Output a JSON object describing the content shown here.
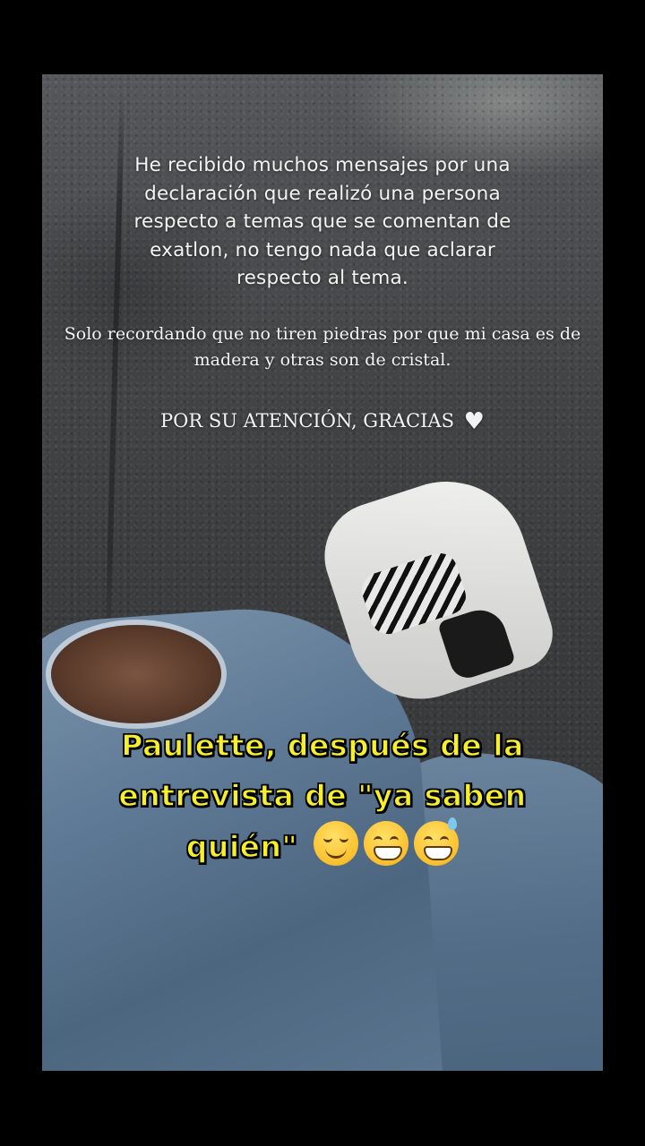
{
  "story": {
    "message_1": "He recibido muchos mensajes por una declaración que realizó una persona respecto a temas que se comentan de exatlon, no tengo nada que aclarar respecto al tema.",
    "message_2": "Solo recordando que no tiren piedras por que mi casa es de madera y otras son de cristal.",
    "message_3": "POR SU ATENCIÓN, GRACIAS",
    "heart_icon": "white-heart-icon"
  },
  "caption": {
    "text": "Paulette, después de la entrevista de \"ya saben quién\"",
    "emojis": [
      "relieved-face-icon",
      "grinning-face-icon",
      "grinning-sweat-face-icon"
    ],
    "color": "#f7ef2a"
  }
}
